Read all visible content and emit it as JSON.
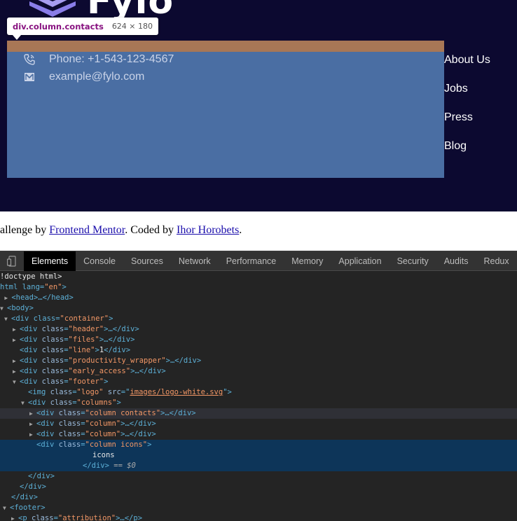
{
  "page": {
    "logo_text": "Fylo",
    "tooltip": {
      "selector": "div.column.contacts",
      "dimensions": "624 × 180"
    },
    "contacts": {
      "phone": "Phone: +1-543-123-4567",
      "email": "example@fylo.com"
    },
    "nav_links": [
      "About Us",
      "Jobs",
      "Press",
      "Blog"
    ],
    "attribution": {
      "prefix": "allenge by ",
      "link1": "Frontend Mentor",
      "middle": ". Coded by ",
      "link2": "Ihor Horobets",
      "suffix": "."
    }
  },
  "devtools": {
    "tabs": [
      "Elements",
      "Console",
      "Sources",
      "Network",
      "Performance",
      "Memory",
      "Application",
      "Security",
      "Audits",
      "Redux"
    ],
    "active_tab": "Elements",
    "dom": {
      "l1": "!doctype html>",
      "l2a": "html lang=",
      "l2b": "\"en\"",
      "l2c": ">",
      "head": "<head>…</head>",
      "body": "<body>",
      "container_tag": "<div class=",
      "container_val": "\"container\"",
      "header_val": "\"header\"",
      "files_val": "\"files\"",
      "line_val": "\"line\"",
      "line_text": "1",
      "productivity_val": "\"productivity_wrapper\"",
      "early_val": "\"early_access\"",
      "footer_val": "\"footer\"",
      "img_class": "\"logo\"",
      "img_src": "images/logo-white.svg",
      "columns_val": "\"columns\"",
      "col_contacts_val": "\"column contacts\"",
      "col_val": "\"column\"",
      "col_icons_val": "\"column icons\"",
      "icons_text": "icons",
      "eq_text": "== $0",
      "close_div": "</div>",
      "footer_tag": "<footer>",
      "attribution_val": "\"attribution\""
    }
  },
  "colors": {
    "page_dark": "#0c0930",
    "highlight_content": "#4a6ea3",
    "highlight_margin": "#a87756",
    "devtools_bg": "#242424",
    "selected_row": "#0d3559"
  }
}
